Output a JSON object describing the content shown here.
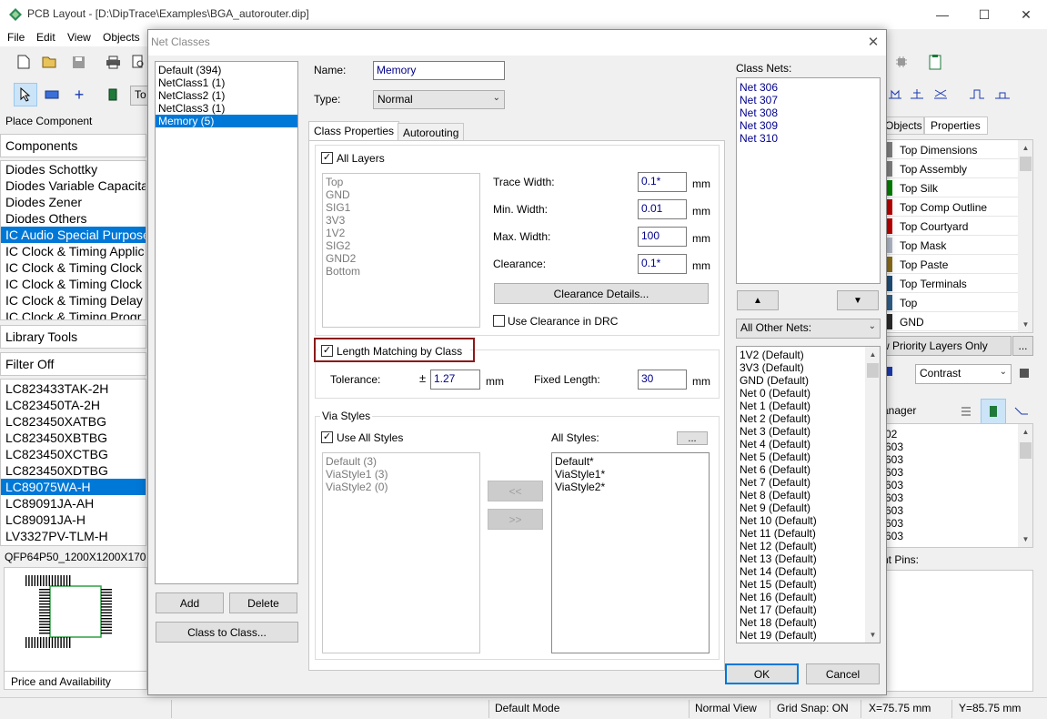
{
  "window": {
    "title": "PCB Layout - [D:\\DipTrace\\Examples\\BGA_autorouter.dip]",
    "minimize": "—",
    "maximize": "☐",
    "close": "✕"
  },
  "menu": [
    "File",
    "Edit",
    "View",
    "Objects"
  ],
  "toolbar": {
    "mode_combo_text": "To"
  },
  "left_panel": {
    "place_component": "Place Component",
    "components_header": "Components",
    "components": [
      "Diodes Schottky",
      "Diodes Variable Capacita",
      "Diodes Zener",
      "Diodes Others",
      "IC Audio Special Purpose",
      "IC Clock & Timing Applic",
      "IC Clock & Timing Clock",
      "IC Clock & Timing Clock",
      "IC Clock & Timing Delay",
      "IC Clock & Timing Progr"
    ],
    "components_selected_index": 4,
    "library_tools": "Library Tools",
    "filter": "Filter Off",
    "parts": [
      "LC823433TAK-2H",
      "LC823450TA-2H",
      "LC823450XATBG",
      "LC823450XBTBG",
      "LC823450XCTBG",
      "LC823450XDTBG",
      "LC89075WA-H",
      "LC89091JA-AH",
      "LC89091JA-H",
      "LV3327PV-TLM-H"
    ],
    "parts_selected_index": 6,
    "pattern_name": "QFP64P50_1200X1200X170",
    "price": "Price and Availability"
  },
  "right_panel": {
    "tabs": [
      "Objects",
      "Properties"
    ],
    "layers": [
      {
        "name": "Top Dimensions",
        "color": "#808080"
      },
      {
        "name": "Top Assembly",
        "color": "#808080"
      },
      {
        "name": "Top Silk",
        "color": "#008000"
      },
      {
        "name": "Top Comp Outline",
        "color": "#c00000"
      },
      {
        "name": "Top Courtyard",
        "color": "#c00000"
      },
      {
        "name": "Top Mask",
        "color": "#b0b8c8"
      },
      {
        "name": "Top Paste",
        "color": "#8a6d1a"
      },
      {
        "name": "Top Terminals",
        "color": "#1f4e79"
      },
      {
        "name": "Top",
        "color": "#2f5f8a"
      },
      {
        "name": "GND",
        "color": "#2a2a2a"
      }
    ],
    "priority_btn": "w Priority Layers Only",
    "more_btn": "...",
    "contrast": "Contrast",
    "manager_label": "anager",
    "manager_items": [
      "02",
      "603",
      "603",
      "603",
      "603",
      "603",
      "603",
      "603",
      "603"
    ],
    "pins_label": "nt Pins:"
  },
  "status": {
    "mode": "Default Mode",
    "view": "Normal View",
    "grid": "Grid Snap: ON",
    "x": "X=75.75 mm",
    "y": "Y=85.75 mm"
  },
  "dialog": {
    "title": "Net Classes",
    "classes": [
      "Default (394)",
      "NetClass1 (1)",
      "NetClass2 (1)",
      "NetClass3 (1)",
      "Memory (5)"
    ],
    "classes_selected_index": 4,
    "add_btn": "Add",
    "delete_btn": "Delete",
    "class_to_class_btn": "Class to Class...",
    "name_label": "Name:",
    "name_value": "Memory",
    "type_label": "Type:",
    "type_value": "Normal",
    "tabs": [
      "Class Properties",
      "Autorouting"
    ],
    "all_layers_label": "All Layers",
    "all_layers_checked": "✓",
    "layers": [
      "Top",
      "GND",
      "SIG1",
      "3V3",
      "1V2",
      "SIG2",
      "GND2",
      "Bottom"
    ],
    "trace_width_label": "Trace Width:",
    "trace_width": "0.1*",
    "min_width_label": "Min. Width:",
    "min_width": "0.01",
    "max_width_label": "Max. Width:",
    "max_width": "100",
    "clearance_label": "Clearance:",
    "clearance": "0.1*",
    "unit": "mm",
    "clearance_details_btn": "Clearance Details...",
    "use_clearance_drc": "Use Clearance in DRC",
    "length_matching": "Length Matching by Class",
    "length_matching_checked": "✓",
    "tolerance_label": "Tolerance:",
    "tolerance_pm": "±",
    "tolerance": "1.27",
    "fixed_length_label": "Fixed Length:",
    "fixed_length": "30",
    "via_styles_label": "Via Styles",
    "use_all_styles": "Use All Styles",
    "use_all_styles_checked": "✓",
    "all_styles_label": "All Styles:",
    "all_styles_more": "...",
    "class_styles": [
      "Default (3)",
      "ViaStyle1 (3)",
      "ViaStyle2 (0)"
    ],
    "all_styles": [
      "Default*",
      "ViaStyle1*",
      "ViaStyle2*"
    ],
    "move_left_btn": "<<",
    "move_right_btn": ">>",
    "class_nets_label": "Class Nets:",
    "class_nets": [
      "Net 306",
      "Net 307",
      "Net 308",
      "Net 309",
      "Net 310"
    ],
    "up_btn": "▲",
    "down_btn": "▼",
    "other_nets_filter": "All Other Nets:",
    "other_nets": [
      "1V2 (Default)",
      "3V3 (Default)",
      "GND (Default)",
      "Net 0 (Default)",
      "Net 1 (Default)",
      "Net 2 (Default)",
      "Net 3 (Default)",
      "Net 4 (Default)",
      "Net 5 (Default)",
      "Net 6 (Default)",
      "Net 7 (Default)",
      "Net 8 (Default)",
      "Net 9 (Default)",
      "Net 10 (Default)",
      "Net 11 (Default)",
      "Net 12 (Default)",
      "Net 13 (Default)",
      "Net 14 (Default)",
      "Net 15 (Default)",
      "Net 16 (Default)",
      "Net 17 (Default)",
      "Net 18 (Default)",
      "Net 19 (Default)"
    ],
    "ok_btn": "OK",
    "cancel_btn": "Cancel"
  }
}
